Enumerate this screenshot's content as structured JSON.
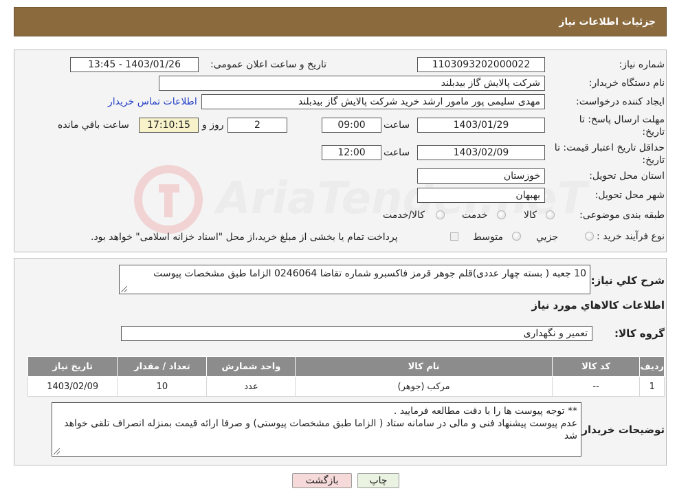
{
  "header": {
    "title": "جزئیات اطلاعات نیاز"
  },
  "watermark": {
    "text": "AriaTender.neT"
  },
  "form": {
    "need_number_label": "شماره نیاز:",
    "need_number": "1103093202000022",
    "announce_label": "تاریخ و ساعت اعلان عمومی:",
    "announce_value": "1403/01/26 - 13:45",
    "buyer_org_label": "نام دستگاه خریدار:",
    "buyer_org": "شرکت پالایش گاز بیدبلند",
    "creator_label": "ایجاد کننده درخواست:",
    "creator": "مهدی سلیمی پور مامور ارشد خرید شرکت پالایش گاز بیدبلند",
    "contact_link": "اطلاعات تماس خریدار",
    "deadline_label_1": "مهلت ارسال پاسخ: تا",
    "deadline_label_2": "تاریخ:",
    "deadline_date": "1403/01/29",
    "time_label": "ساعت",
    "deadline_time": "09:00",
    "days_value": "2",
    "days_label": "روز و",
    "remaining_time": "17:10:15",
    "remaining_label": "ساعت باقي مانده",
    "validity_label_1": "حداقل تاریخ اعتبار قیمت: تا",
    "validity_label_2": "تاریخ:",
    "validity_date": "1403/02/09",
    "validity_time_label": "ساعت",
    "validity_time": "12:00",
    "province_label": "استان محل تحویل:",
    "province": "خوزستان",
    "city_label": "شهر محل تحویل:",
    "city": "بهبهان",
    "category_label": "طبقه بندی موضوعی:",
    "category_options": [
      "کالا",
      "خدمت",
      "کالا/خدمت"
    ],
    "process_label": "نوع فرآیند خرید :",
    "process_options": [
      "جزیي",
      "متوسط"
    ],
    "process_note": "پرداخت تمام یا بخشی از مبلغ خرید،از محل \"اسناد خزانه اسلامی\" خواهد بود."
  },
  "details": {
    "summary_label": "شرح کلي نیاز:",
    "summary": "10 جعبه ( بسته چهار  عددی)قلم جوهر قرمز فاکسبرو شماره تقاضا   0246064 الزاما طبق مشخصات پیوست",
    "goods_info_title": "اطلاعات کالاهاي مورد نیاز",
    "goods_group_label": "گروه کالا:",
    "goods_group": "تعمیر و نگهداری",
    "table_headers": [
      "ردیف",
      "کد کالا",
      "نام کالا",
      "واحد شمارش",
      "تعداد / مقدار",
      "تاریخ نیاز"
    ],
    "table_rows": [
      [
        "1",
        "--",
        "مرکب (جوهر)",
        "عدد",
        "10",
        "1403/02/09"
      ]
    ],
    "buyer_notes_label": "توضیحات خریدار:",
    "buyer_notes_line1": "** توجه پیوست ها  را با دقت مطالعه فرمایید .",
    "buyer_notes_line2": "عدم پیوست پیشنهاد فنی و مالی در سامانه ستاد ( الزاما طبق مشخصات پیوستی)  و صرفا ارائه قیمت بمنزله انصراف تلقی خواهد شد"
  },
  "buttons": {
    "print": "چاپ",
    "back": "بازگشت"
  },
  "colors": {
    "header_bg": "#8b6a3e",
    "table_header_bg": "#8c8c8c",
    "back_button_bg": "#f6d9d9",
    "print_button_bg": "#eaf3e1"
  }
}
